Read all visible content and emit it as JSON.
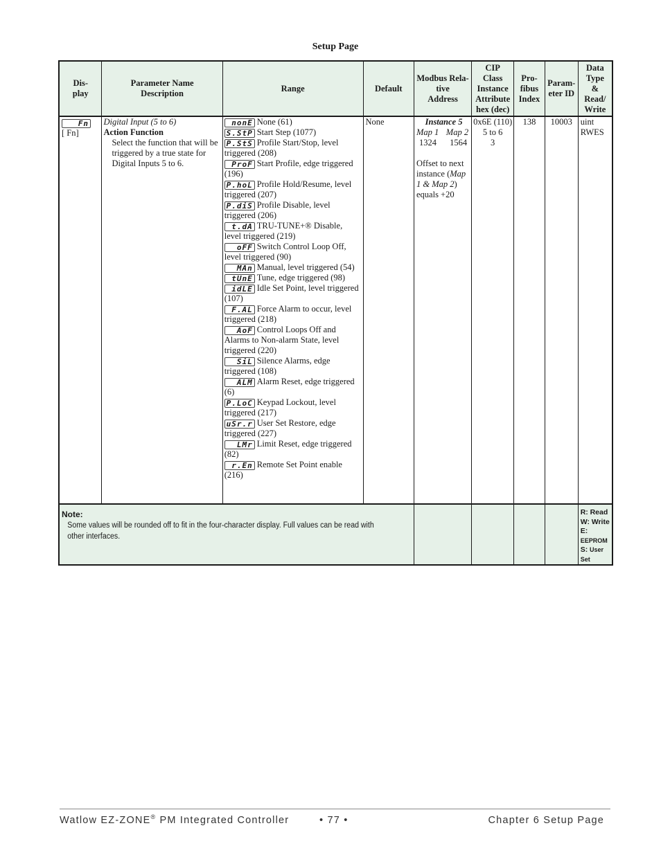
{
  "page": {
    "title": "Setup Page"
  },
  "table": {
    "headers": {
      "display": "Dis-\nplay",
      "param_name": "Parameter Name Description",
      "range": "Range",
      "default": "Default",
      "modbus": "Modbus Rela-tive Address",
      "cip": "CIP Class Instance Attribute hex (dec)",
      "profibus": "Pro-fibus Index",
      "param_id": "Param-eter ID",
      "data_type": "Data Type & Read/ Write"
    },
    "headers_lines": {
      "display": [
        "Dis-",
        "play"
      ],
      "param_name": [
        "Parameter Name",
        "Description"
      ],
      "modbus": [
        "Modbus Rela-",
        "tive",
        "Address"
      ],
      "cip": [
        "CIP",
        "Class",
        "Instance",
        "Attribute",
        "hex (dec)"
      ],
      "profibus": [
        "Pro-",
        "fibus",
        "Index"
      ],
      "param_id": [
        "Param-",
        "eter ID"
      ],
      "data_type": [
        "Data",
        "Type",
        "&",
        "Read/",
        "Write"
      ]
    },
    "row": {
      "display_code": "Fn",
      "display_label": "[  Fn]",
      "group": "Digital Input (5 to 6)",
      "name": "Action Function",
      "description": "Select the function that will be triggered by a true state for Digital Inputs 5 to 6.",
      "range": [
        {
          "code": "nonE",
          "text": "None (61)"
        },
        {
          "code": "S.StP",
          "text": "Start Step (1077)"
        },
        {
          "code": "P.StS",
          "text": "Profile Start/Stop, level triggered (208)"
        },
        {
          "code": "ProF",
          "text": "Start Profile, edge triggered (196)"
        },
        {
          "code": "P.hoL",
          "text": "Profile Hold/Resume, level triggered (207)"
        },
        {
          "code": "P.diS",
          "text": "Profile Disable, level triggered (206)"
        },
        {
          "code": "t.dA",
          "text": "TRU-TUNE+® Disable, level triggered (219)"
        },
        {
          "code": "oFF",
          "text": "Switch Control Loop Off, level triggered (90)"
        },
        {
          "code": "MAn",
          "text": "Manual, level triggered (54)"
        },
        {
          "code": "tUnE",
          "text": "Tune, edge triggered (98)"
        },
        {
          "code": "idLE",
          "text": "Idle Set Point, level triggered (107)"
        },
        {
          "code": "F.AL",
          "text": "Force Alarm to occur, level triggered (218)"
        },
        {
          "code": "AoF",
          "text": "Control Loops Off and Alarms to Non-alarm State, level triggered (220)"
        },
        {
          "code": "SiL",
          "text": "Silence Alarms, edge triggered (108)"
        },
        {
          "code": "ALM",
          "text": "Alarm Reset, edge triggered (6)"
        },
        {
          "code": "P.LoC",
          "text": "Keypad Lockout, level triggered (217)"
        },
        {
          "code": "uSr.r",
          "text": "User Set Restore, edge triggered (227)"
        },
        {
          "code": "LMr",
          "text": "Limit Reset, edge triggered (82)"
        },
        {
          "code": "r.En",
          "text": "Remote Set Point enable (216)"
        }
      ],
      "default": "None",
      "modbus": {
        "instance": "Instance 5",
        "map1_label": "Map 1",
        "map2_label": "Map 2",
        "map1_value": "1324",
        "map2_value": "1564",
        "offset_text_1": "Offset to next instance (",
        "offset_italic": "Map 1 & Map 2",
        "offset_text_2": ") equals +20"
      },
      "cip": [
        "0x6E (110)",
        "5 to 6",
        "3"
      ],
      "profibus": "138",
      "param_id": "10003",
      "data_type": [
        "uint",
        "RWES"
      ]
    },
    "note": {
      "label": "Note:",
      "text": "Some values will be rounded off to fit in the four-character display. Full values can be read with other interfaces."
    },
    "legend": [
      {
        "key": "R:",
        "value": "Read"
      },
      {
        "key": "W:",
        "value": "Write"
      },
      {
        "key": "E:",
        "value": "EEPROM"
      },
      {
        "key": "S:",
        "value": "User Set"
      }
    ]
  },
  "footer": {
    "product": "Watlow EZ-ZONE",
    "registered": "®",
    "product_rest": " PM Integrated Controller",
    "page_number": "•  77  •",
    "chapter": "Chapter 6 Setup Page"
  }
}
